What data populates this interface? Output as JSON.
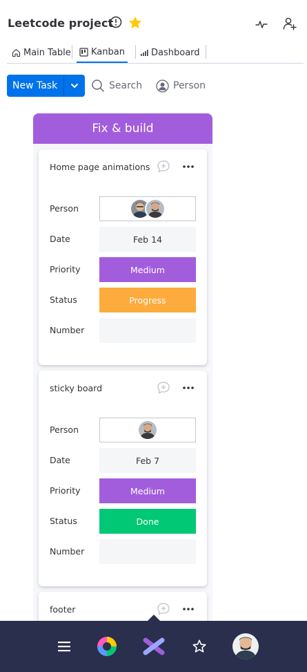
{
  "header": {
    "title": "Leetcode project",
    "icons": [
      "info-icon",
      "star-icon",
      "activity-icon",
      "invite-member-icon"
    ],
    "star_color": "#ffcb00"
  },
  "tabs": [
    {
      "label": "Main Table",
      "icon": "home-icon",
      "active": false
    },
    {
      "label": "Kanban",
      "icon": "kanban-icon",
      "active": true
    },
    {
      "label": "Dashboard",
      "icon": "chart-icon",
      "active": false
    }
  ],
  "toolbar": {
    "new_task_label": "New Task",
    "search_label": "Search",
    "person_label": "Person"
  },
  "column": {
    "title": "Fix & build",
    "color": "#a25ddc"
  },
  "cards": [
    {
      "title": "Home page animations",
      "labels": {
        "person": "Person",
        "date": "Date",
        "priority": "Priority",
        "status": "Status",
        "number": "Number"
      },
      "person_avatars": 2,
      "date": "Feb 14",
      "priority": "Medium",
      "status": "Progress",
      "status_color": "#fdab3d",
      "number": ""
    },
    {
      "title": "sticky board",
      "labels": {
        "person": "Person",
        "date": "Date",
        "priority": "Priority",
        "status": "Status",
        "number": "Number"
      },
      "person_avatars": 1,
      "date": "Feb 7",
      "priority": "Medium",
      "status": "Done",
      "status_color": "#00c875",
      "number": ""
    },
    {
      "title": "footer"
    }
  ],
  "bottom_nav": {
    "items": [
      "menu-icon",
      "apps-icon",
      "monday-logo-icon",
      "favorites-star-icon",
      "profile-avatar"
    ],
    "background": "#292f4c"
  }
}
